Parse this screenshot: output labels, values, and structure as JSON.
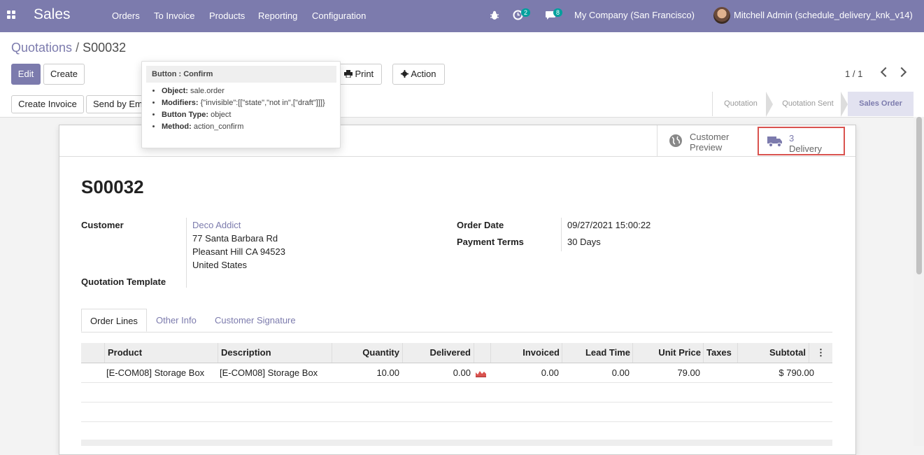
{
  "nav": {
    "app_name": "Sales",
    "menu": [
      "Orders",
      "To Invoice",
      "Products",
      "Reporting",
      "Configuration"
    ],
    "activity_count": "2",
    "messages_count": "8",
    "company": "My Company (San Francisco)",
    "user": "Mitchell Admin (schedule_delivery_knk_v14)"
  },
  "breadcrumb": {
    "parent": "Quotations",
    "separator": "/",
    "current": "S00032"
  },
  "toolbar": {
    "edit": "Edit",
    "create": "Create",
    "print": "Print",
    "action": "Action"
  },
  "pager": {
    "value": "1 / 1"
  },
  "status_buttons": {
    "create_invoice": "Create Invoice",
    "send_by_email": "Send by Em"
  },
  "stages": [
    {
      "label": "Quotation",
      "active": false
    },
    {
      "label": "Quotation Sent",
      "active": false
    },
    {
      "label": "Sales Order",
      "active": true
    }
  ],
  "tooltip": {
    "title": "Button : Confirm",
    "object_label": "Object:",
    "object_value": "sale.order",
    "modifiers_label": "Modifiers:",
    "modifiers_value": "{\"invisible\":[[\"state\",\"not in\",[\"draft\"]]]}",
    "type_label": "Button Type:",
    "type_value": "object",
    "method_label": "Method:",
    "method_value": "action_confirm"
  },
  "smart_buttons": {
    "preview_line1": "Customer",
    "preview_line2": "Preview",
    "delivery_count": "3",
    "delivery_label": "Delivery"
  },
  "record": {
    "name": "S00032",
    "customer_label": "Customer",
    "customer_name": "Deco Addict",
    "address_line1": "77 Santa Barbara Rd",
    "address_line2": "Pleasant Hill CA 94523",
    "address_line3": "United States",
    "template_label": "Quotation Template",
    "order_date_label": "Order Date",
    "order_date": "09/27/2021 15:00:22",
    "payment_terms_label": "Payment Terms",
    "payment_terms": "30 Days"
  },
  "tabs": [
    "Order Lines",
    "Other Info",
    "Customer Signature"
  ],
  "lines": {
    "headers": [
      "Product",
      "Description",
      "Quantity",
      "Delivered",
      "Invoiced",
      "Lead Time",
      "Unit Price",
      "Taxes",
      "Subtotal"
    ],
    "rows": [
      {
        "product": "[E-COM08] Storage Box",
        "description": "[E-COM08] Storage Box",
        "quantity": "10.00",
        "delivered": "0.00",
        "invoiced": "0.00",
        "lead_time": "0.00",
        "unit_price": "79.00",
        "taxes": "",
        "subtotal": "$ 790.00"
      }
    ]
  },
  "colors": {
    "brand": "#7c7bad",
    "accent": "#00a09d",
    "highlight_border": "#d9534f"
  }
}
